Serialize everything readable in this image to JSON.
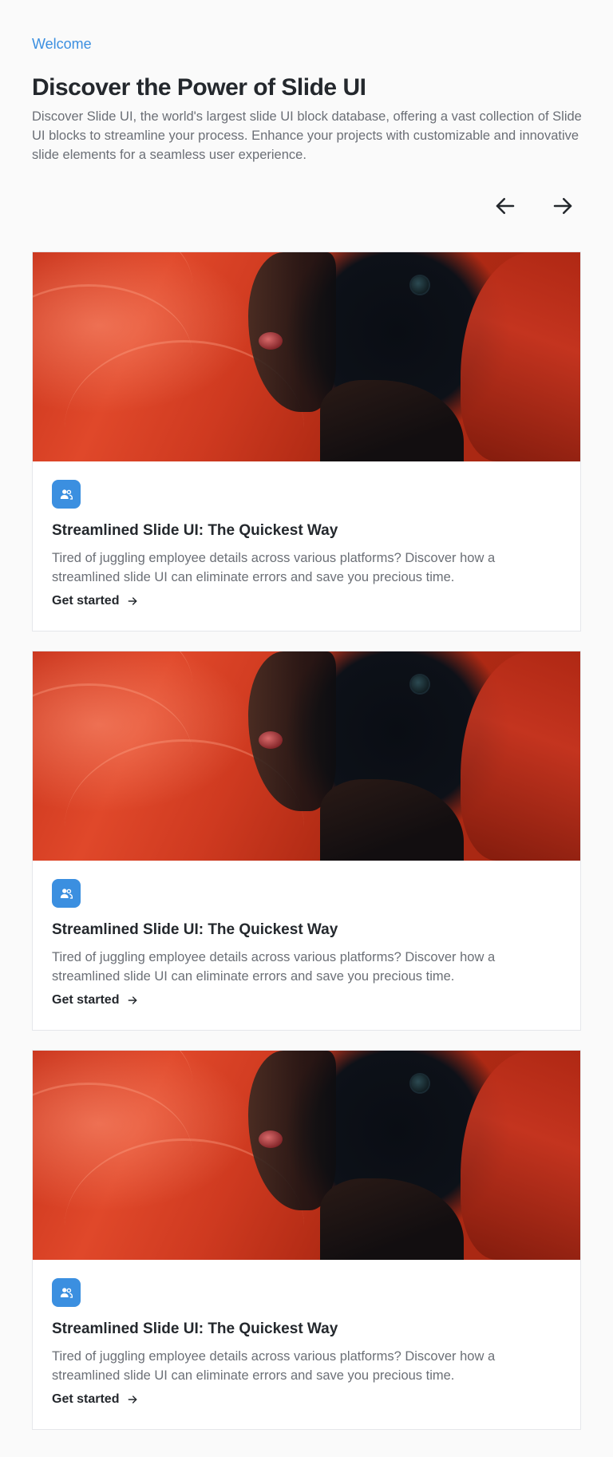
{
  "header": {
    "eyebrow": "Welcome",
    "title": "Discover the Power of Slide UI",
    "description": "Discover Slide UI, the world's largest slide UI block database, offering a vast collection of Slide UI blocks to streamline your process. Enhance your projects with customizable and innovative slide elements for a seamless user experience."
  },
  "carousel_nav": {
    "prev_icon": "arrow-left-icon",
    "next_icon": "arrow-right-icon"
  },
  "cards": [
    {
      "image": "portrait-red-drape-image",
      "badge_icon": "users-icon",
      "title": "Streamlined Slide UI: The Quickest Way",
      "text": "Tired of juggling employee details across various platforms? Discover how a streamlined slide UI can eliminate errors and save you precious time.",
      "link_label": "Get started",
      "link_icon": "arrow-right-icon"
    },
    {
      "image": "portrait-red-drape-image",
      "badge_icon": "users-icon",
      "title": "Streamlined Slide UI: The Quickest Way",
      "text": "Tired of juggling employee details across various platforms? Discover how a streamlined slide UI can eliminate errors and save you precious time.",
      "link_label": "Get started",
      "link_icon": "arrow-right-icon"
    },
    {
      "image": "portrait-red-drape-image",
      "badge_icon": "users-icon",
      "title": "Streamlined Slide UI: The Quickest Way",
      "text": "Tired of juggling employee details across various platforms? Discover how a streamlined slide UI can eliminate errors and save you precious time.",
      "link_label": "Get started",
      "link_icon": "arrow-right-icon"
    }
  ],
  "colors": {
    "accent": "#3b8fe0",
    "heading": "#24282d",
    "body_text": "#6b6f76",
    "card_border": "#e5e7eb"
  }
}
